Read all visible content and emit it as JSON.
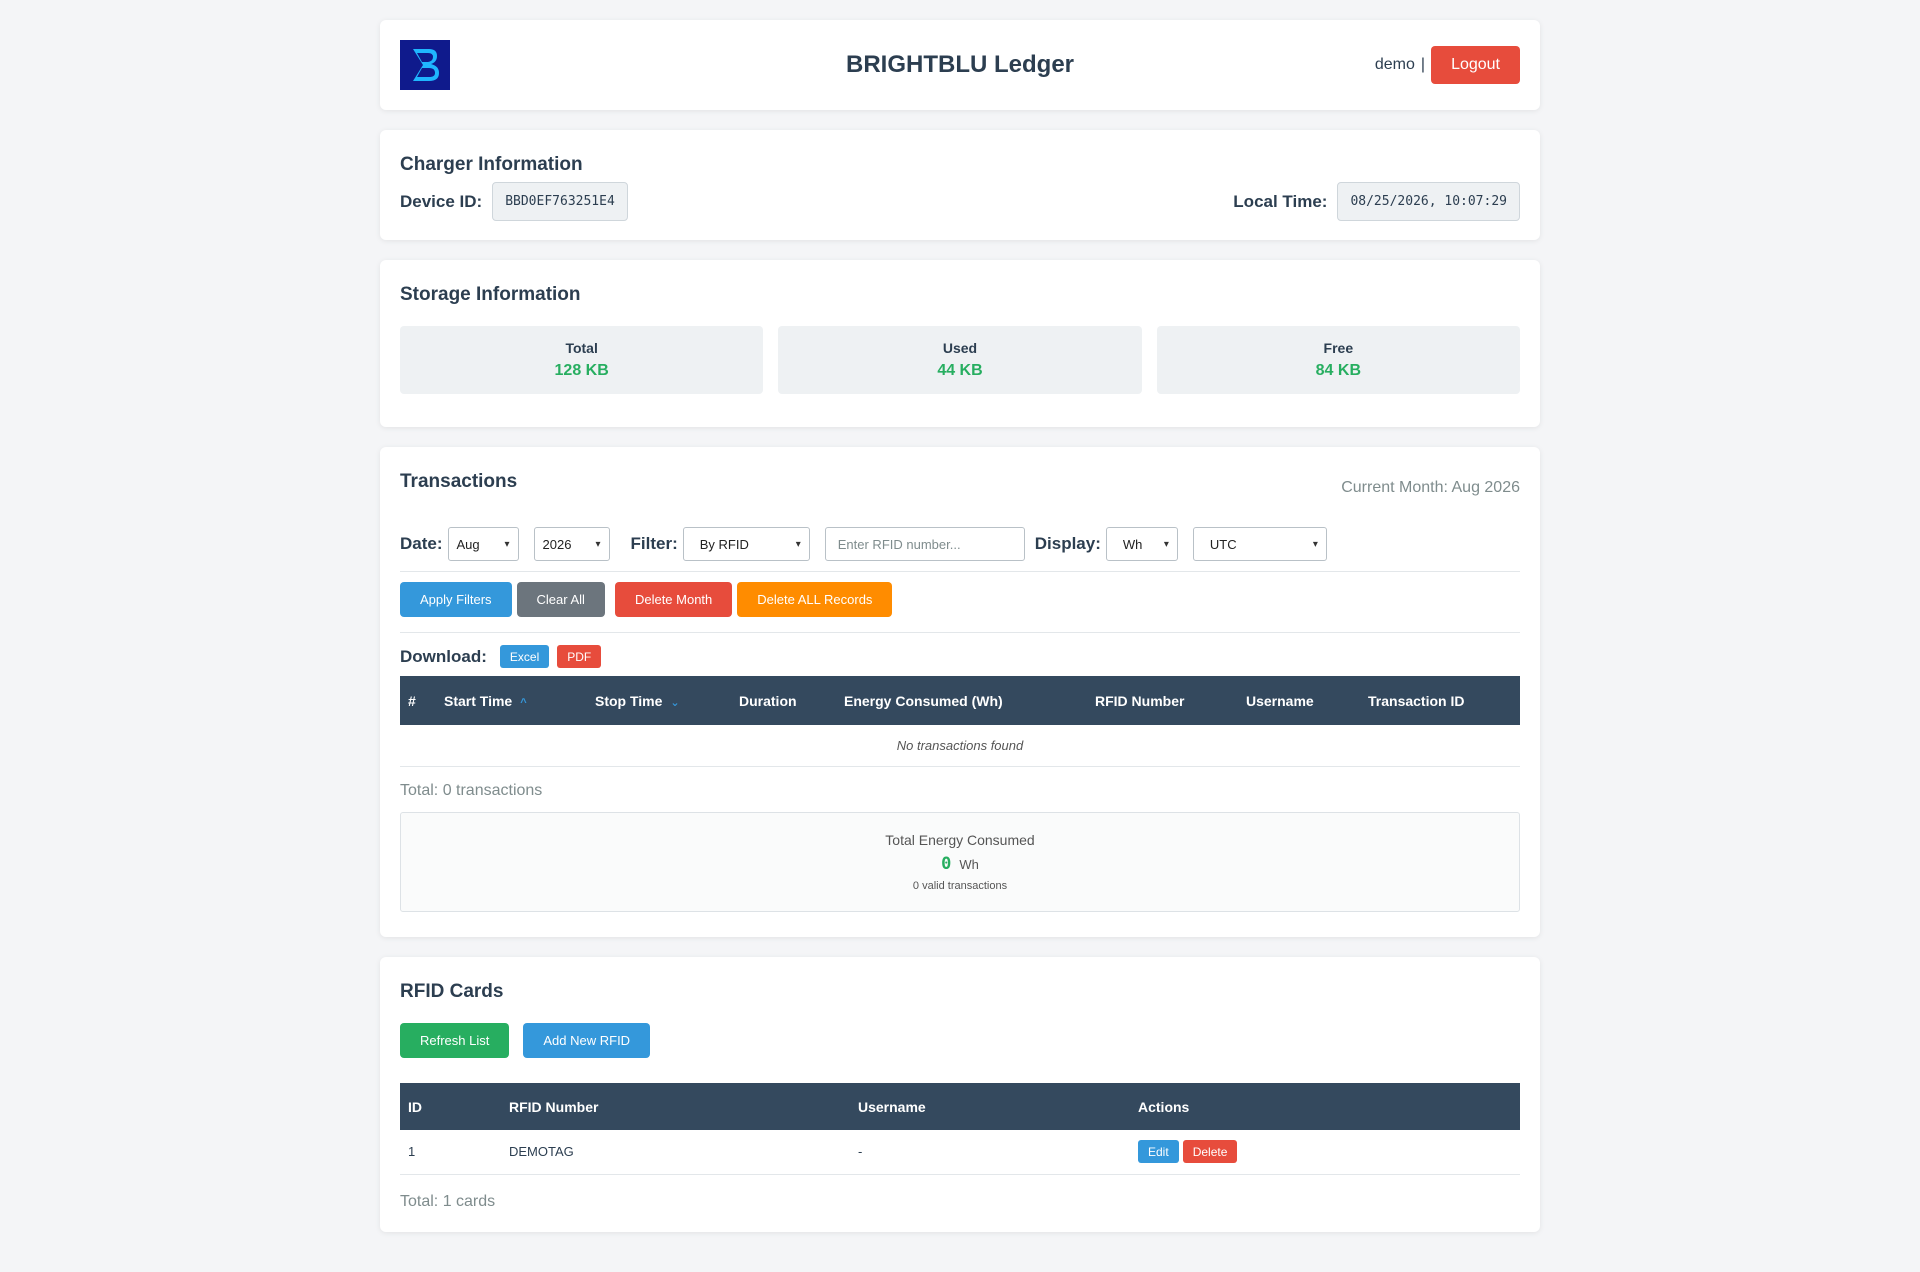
{
  "header": {
    "title": "BRIGHTBLU Ledger",
    "username": "demo",
    "separator": "|",
    "logout_label": "Logout"
  },
  "charger": {
    "title": "Charger Information",
    "device_id_label": "Device ID:",
    "device_id": "BBD0EF763251E4",
    "local_time_label": "Local Time:",
    "local_time": "08/25/2026, 10:07:29"
  },
  "storage": {
    "title": "Storage Information",
    "total_label": "Total",
    "total_value": "128 KB",
    "used_label": "Used",
    "used_value": "44 KB",
    "free_label": "Free",
    "free_value": "84 KB"
  },
  "transactions": {
    "title": "Transactions",
    "current_month": "Current Month: Aug 2026",
    "date_label": "Date:",
    "month_value": "Aug",
    "year_value": "2026",
    "filter_label": "Filter:",
    "filter_value": "By RFID",
    "rfid_placeholder": "Enter RFID number...",
    "display_label": "Display:",
    "unit_value": "Wh",
    "tz_value": "UTC",
    "apply_label": "Apply Filters",
    "clear_label": "Clear All",
    "delete_month_label": "Delete Month",
    "delete_all_label": "Delete ALL Records",
    "download_label": "Download:",
    "excel_label": "Excel",
    "pdf_label": "PDF",
    "columns": [
      "#",
      "Start Time",
      "Stop Time",
      "Duration",
      "Energy Consumed (Wh)",
      "RFID Number",
      "Username",
      "Transaction ID"
    ],
    "empty_text": "No transactions found",
    "total_text": "Total: 0 transactions",
    "summary": {
      "title": "Total Energy Consumed",
      "value": "0",
      "unit": "Wh",
      "sub": "0 valid transactions"
    }
  },
  "rfid": {
    "title": "RFID Cards",
    "refresh_label": "Refresh List",
    "add_label": "Add New RFID",
    "columns": [
      "ID",
      "RFID Number",
      "Username",
      "Actions"
    ],
    "rows": [
      {
        "id": "1",
        "rfid": "DEMOTAG",
        "username": "-"
      }
    ],
    "edit_label": "Edit",
    "delete_label": "Delete",
    "total_text": "Total: 1 cards"
  },
  "colors": {
    "primary": "#3498db",
    "danger": "#e74c3c",
    "success": "#27ae60",
    "warning": "#ff8c00",
    "header_dark": "#34495e"
  },
  "icons": {
    "logo": "brightblu-logo",
    "sort_asc": "sort-asc-icon",
    "sort_desc": "sort-desc-icon",
    "select": "chevron-down-icon"
  }
}
